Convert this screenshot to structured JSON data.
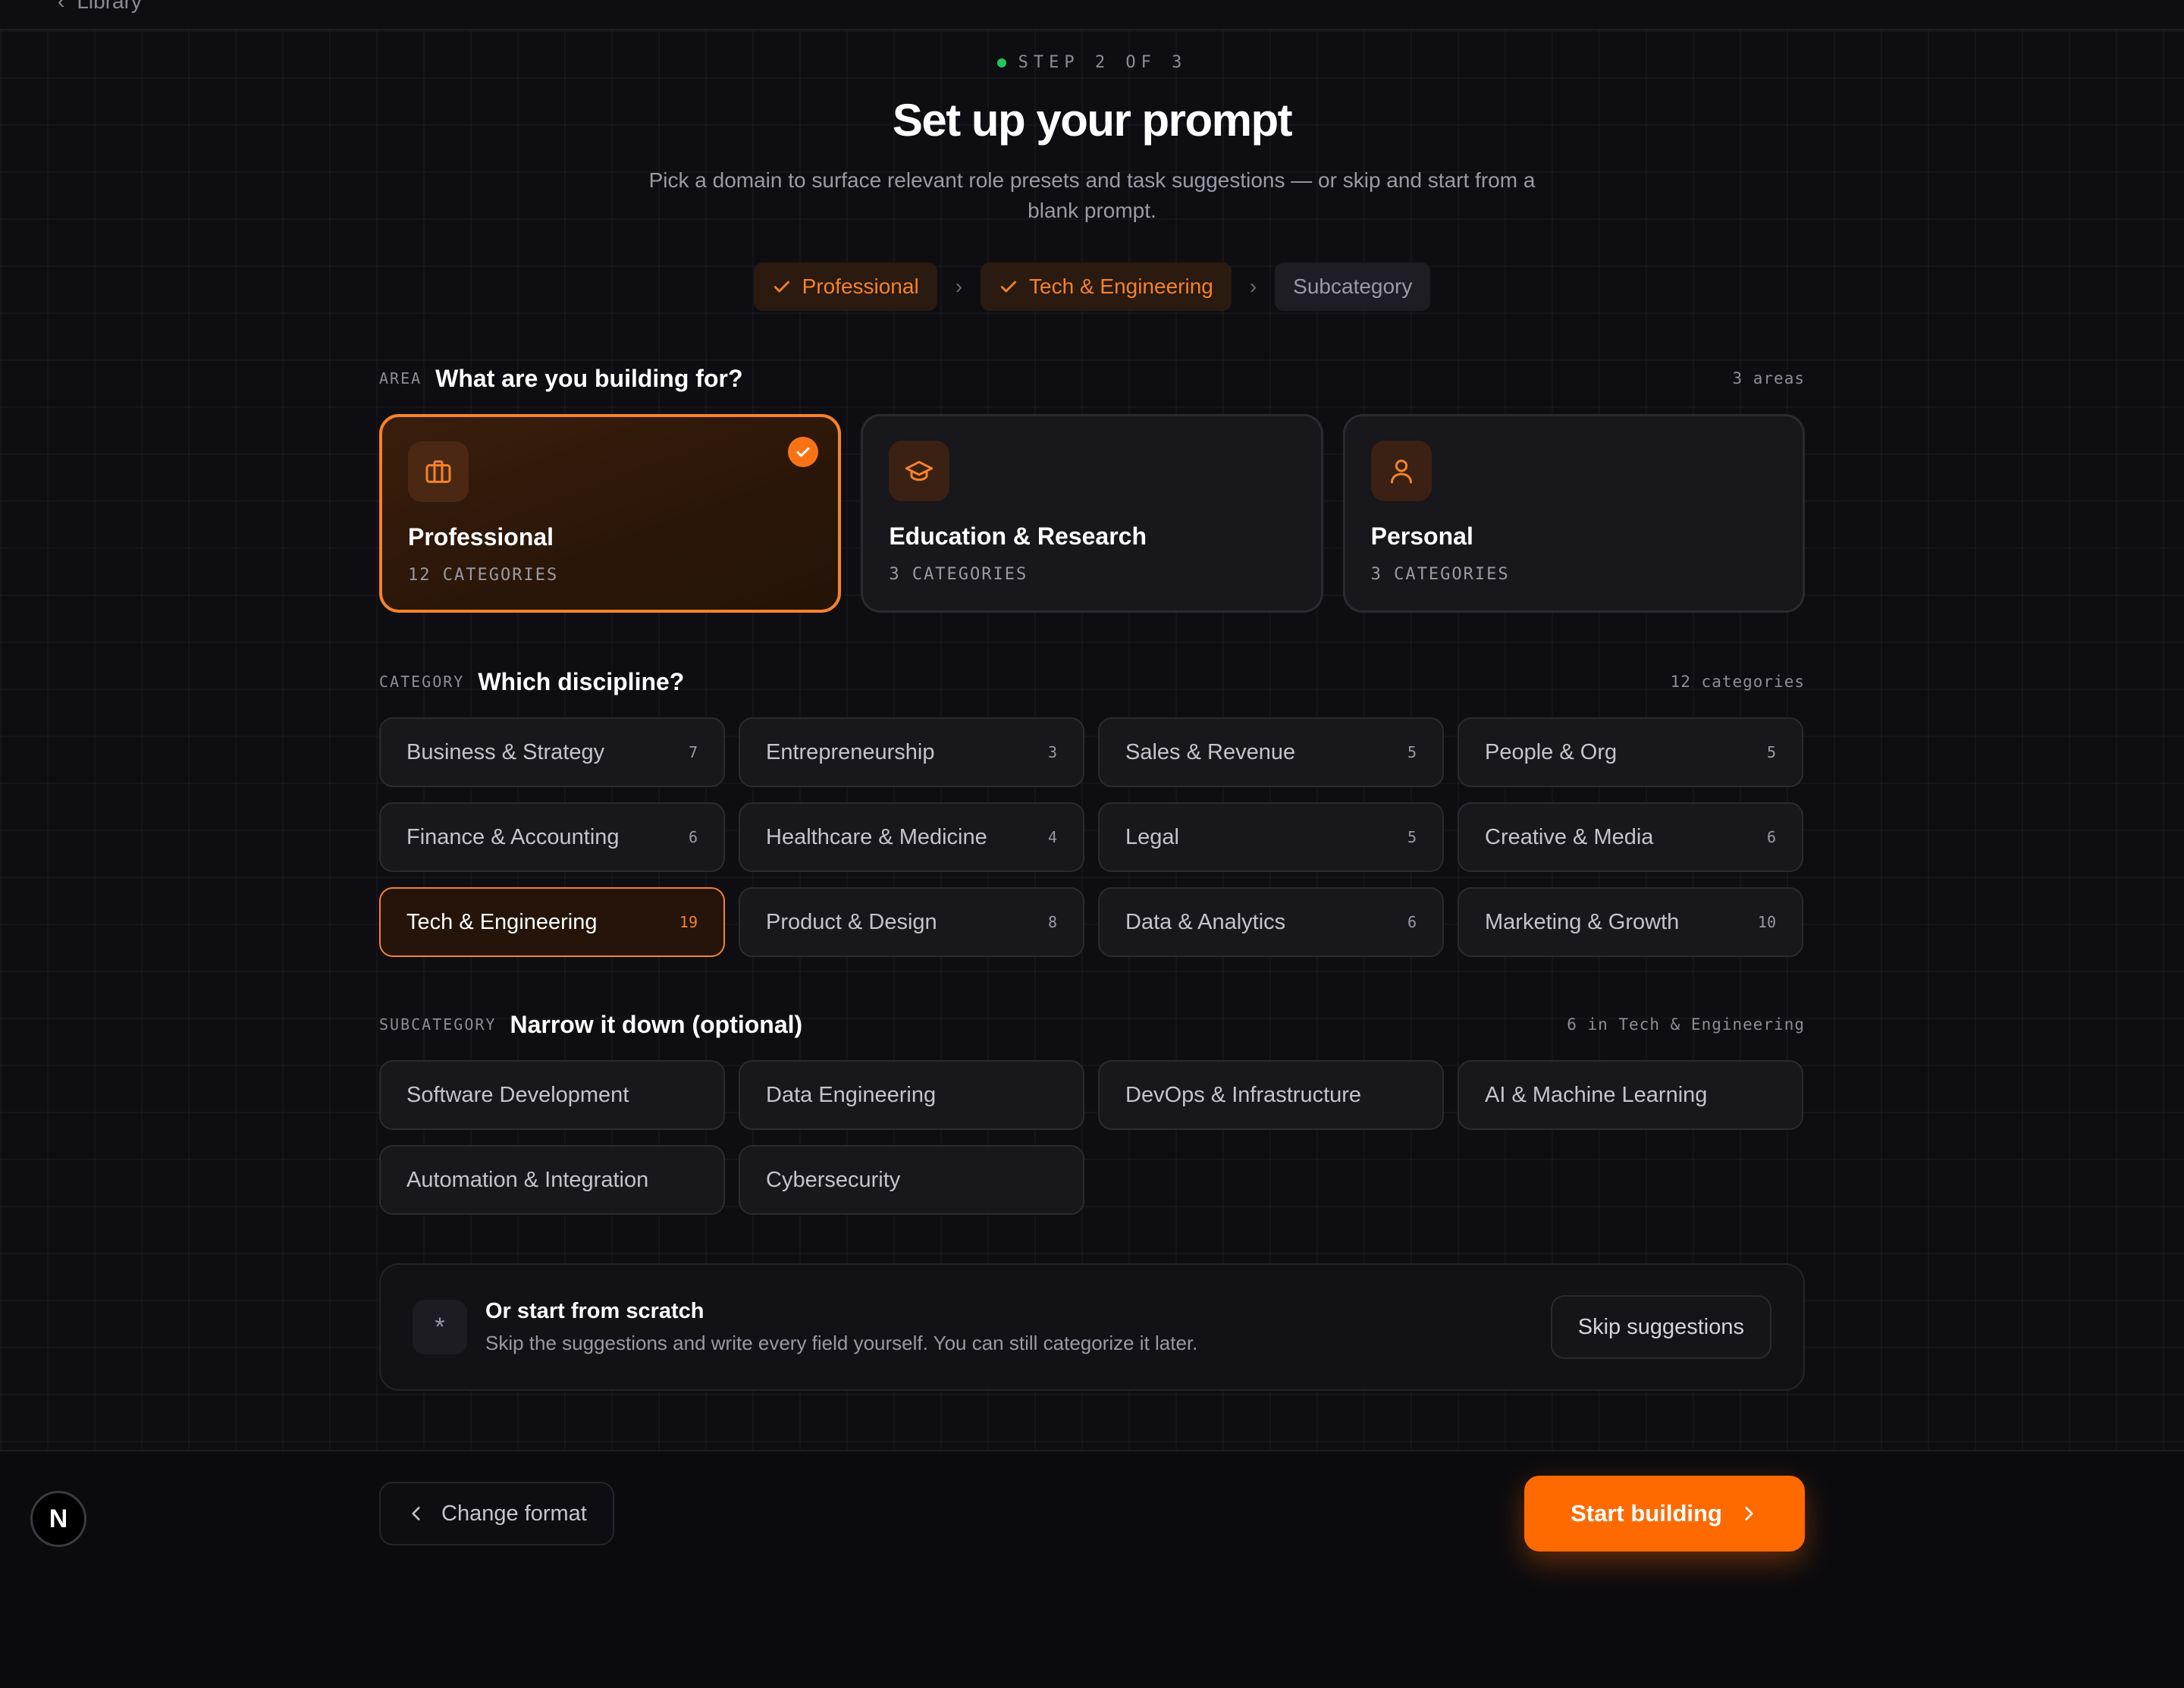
{
  "topbar": {
    "back_label": "Library"
  },
  "step_label": "STEP 2 OF 3",
  "title": "Set up your prompt",
  "subtitle": "Pick a domain to surface relevant role presets and task suggestions — or skip and start from a blank prompt.",
  "breadcrumb": {
    "items": [
      {
        "label": "Professional",
        "done": true
      },
      {
        "label": "Tech & Engineering",
        "done": true
      },
      {
        "label": "Subcategory",
        "done": false
      }
    ]
  },
  "area_section": {
    "kicker": "AREA",
    "title": "What are you building for?",
    "count": "3 areas",
    "cards": [
      {
        "name": "Professional",
        "sub": "12 CATEGORIES",
        "icon": "briefcase-icon",
        "selected": true
      },
      {
        "name": "Education & Research",
        "sub": "3 CATEGORIES",
        "icon": "graduation-cap-icon",
        "selected": false
      },
      {
        "name": "Personal",
        "sub": "3 CATEGORIES",
        "icon": "user-icon",
        "selected": false
      }
    ]
  },
  "category_section": {
    "kicker": "CATEGORY",
    "title": "Which discipline?",
    "count": "12 categories",
    "items": [
      {
        "label": "Business & Strategy",
        "count": "7"
      },
      {
        "label": "Entrepreneurship",
        "count": "3"
      },
      {
        "label": "Sales & Revenue",
        "count": "5"
      },
      {
        "label": "People & Org",
        "count": "5"
      },
      {
        "label": "Finance & Accounting",
        "count": "6"
      },
      {
        "label": "Healthcare & Medicine",
        "count": "4"
      },
      {
        "label": "Legal",
        "count": "5"
      },
      {
        "label": "Creative & Media",
        "count": "6"
      },
      {
        "label": "Tech & Engineering",
        "count": "19",
        "active": true
      },
      {
        "label": "Product & Design",
        "count": "8"
      },
      {
        "label": "Data & Analytics",
        "count": "6"
      },
      {
        "label": "Marketing & Growth",
        "count": "10"
      }
    ]
  },
  "subcategory_section": {
    "kicker": "SUBCATEGORY",
    "title": "Narrow it down (optional)",
    "count": "6 in Tech & Engineering",
    "items": [
      {
        "label": "Software Development"
      },
      {
        "label": "Data Engineering"
      },
      {
        "label": "DevOps & Infrastructure"
      },
      {
        "label": "AI & Machine Learning"
      },
      {
        "label": "Automation & Integration"
      },
      {
        "label": "Cybersecurity"
      }
    ]
  },
  "scratch": {
    "icon_glyph": "*",
    "title": "Or start from scratch",
    "description": "Skip the suggestions and write every field yourself. You can still categorize it later.",
    "skip_label": "Skip suggestions"
  },
  "footer": {
    "change_label": "Change format",
    "start_label": "Start building",
    "badge_letter": "N"
  },
  "colors": {
    "accent": "#ff6a00",
    "accent_text": "#f5822a",
    "status_dot": "#22c55e",
    "background": "#0e0e12"
  }
}
